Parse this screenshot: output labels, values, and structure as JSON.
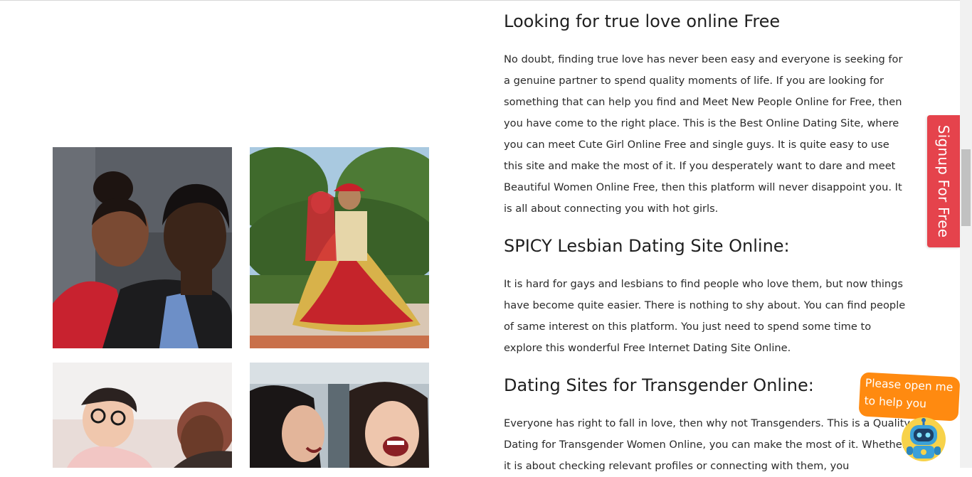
{
  "article": {
    "heading1": "Looking for true love online Free",
    "paragraph1": "No doubt, finding true love has never been easy and everyone is seeking for a genuine partner to spend quality moments of life. If you are looking for something that can help you find and Meet New People Online for Free, then you have come to the right place. This is the Best Online Dating Site, where you can meet Cute Girl Online Free and single guys. It is quite easy to use this site and make the most of it. If you desperately want to dare and meet Beautiful Women Online Free, then this platform will never disappoint you. It is all about connecting you with hot girls.",
    "heading2": "SPICY Lesbian Dating Site Online:",
    "paragraph2": "It is hard for gays and lesbians to find people who love them, but now things have become quite easier. There is nothing to shy about. You can find people of same interest on this platform. You just need to spend some time to explore this wonderful Free Internet Dating Site Online.",
    "heading3": "Dating Sites for Transgender Online:",
    "paragraph3": "Everyone has right to fall in love, then why not Transgenders. This is a Quality Dating for Transgender Women Online, you can make the most of it. Whether it is about checking relevant profiles or connecting with them, you"
  },
  "signup_tab": {
    "label": "Signup For Free"
  },
  "chat_widget": {
    "line1": "Please open me",
    "line2": "to help you",
    "icon": "robot-icon"
  },
  "photos": [
    {
      "name": "couple-photo",
      "icon": "photo-icon"
    },
    {
      "name": "wedding-photo",
      "icon": "photo-icon"
    },
    {
      "name": "friends-photo",
      "icon": "photo-icon"
    },
    {
      "name": "women-laughing-photo",
      "icon": "photo-icon"
    }
  ],
  "colors": {
    "signup_tab": "#e5434c",
    "chat_bubble": "#ff8a10",
    "text": "#2a2a2a"
  }
}
